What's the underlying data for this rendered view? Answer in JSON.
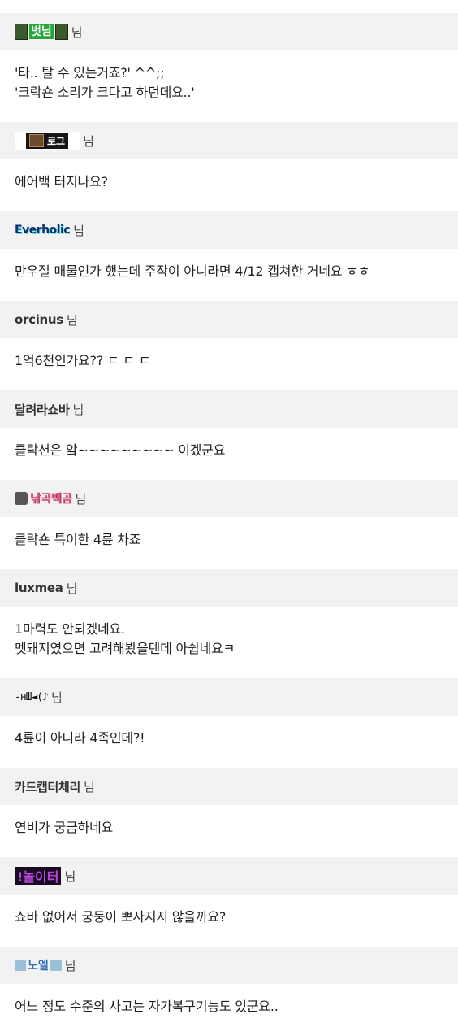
{
  "suffix": "님",
  "comments": [
    {
      "nick": "벗님",
      "lines": [
        "'타.. 탈 수 있는거죠?' ^^;;",
        "'크락숀 소리가 크다고 하던데요..'"
      ]
    },
    {
      "nick": "로그",
      "lines": [
        "에어백 터지나요?"
      ]
    },
    {
      "nick": "Everholic",
      "lines": [
        "만우절 매물인가 했는데 주작이 아니라면 4/12 캡쳐한 거네요 ㅎㅎ"
      ]
    },
    {
      "nick": "orcinus",
      "lines": [
        "1억6천인가요?? ㄷ ㄷ ㄷ"
      ]
    },
    {
      "nick": "달려라쇼바",
      "lines": [
        "클락션은 앜~~~~~~~~~ 이겠군요"
      ]
    },
    {
      "nick": "낚곡백곰",
      "lines": [
        "클략숀 특이한 4륜 차죠"
      ]
    },
    {
      "nick": "luxmea",
      "lines": [
        "1마력도 안되겠네요.",
        "멧돼지였으면 고려해봤을텐데 아쉽네요ㅋ"
      ]
    },
    {
      "nick": "-нШ◄(♪",
      "lines": [
        "4륜이 아니라 4족인데?!"
      ]
    },
    {
      "nick": "카드캡터체리",
      "lines": [
        "연비가 궁금하네요"
      ]
    },
    {
      "nick": "!놀이터",
      "lines": [
        "쇼바 없어서 궁둥이 뽀사지지 않을까요?"
      ]
    },
    {
      "nick": "노엘",
      "lines": [
        "어느 정도 수준의 사고는 자가복구기능도 있군요.."
      ]
    }
  ]
}
